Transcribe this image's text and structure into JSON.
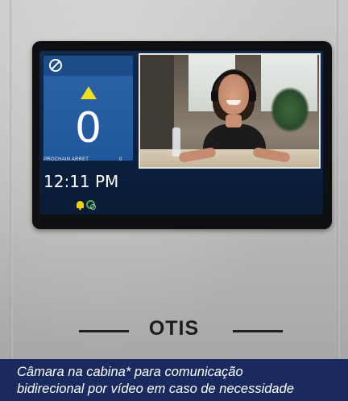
{
  "display": {
    "status_icons": [
      "no-smoking-icon",
      "up-arrow-icon",
      "bell-icon",
      "link-icon"
    ],
    "floor": "0",
    "next_stop_label": "PROCHAIN ARRET",
    "next_stop_value": "0",
    "time": "12:11 PM"
  },
  "brand": {
    "name": "OTIS"
  },
  "caption": {
    "line1": "Câmara na cabina* para comunicação",
    "line2": "bidirecional por vídeo em caso de necessidade"
  },
  "colors": {
    "caption_bg": "#1a2a5e",
    "panel_blue": "#2c63a8",
    "arrow_yellow": "#f0e11c"
  }
}
